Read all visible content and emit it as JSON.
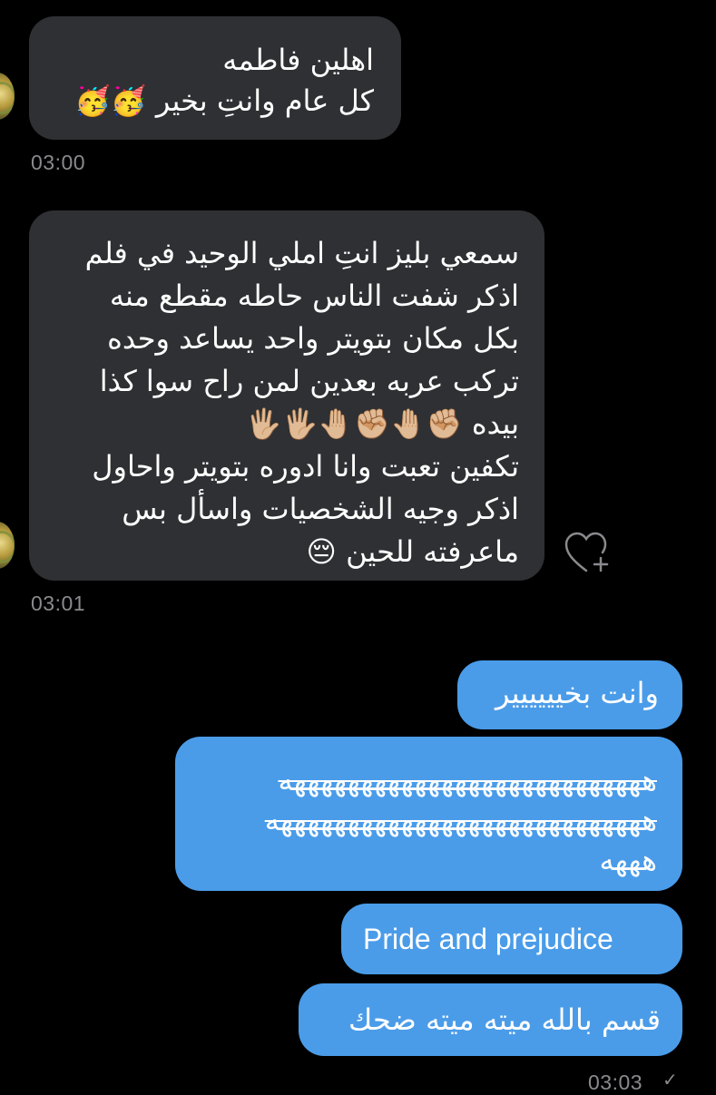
{
  "messages_in": [
    {
      "lines": [
        "اهلين فاطمه",
        "كل عام وانتِ بخير 🥳🥳"
      ],
      "time": "03:00"
    },
    {
      "lines": [
        "سمعي بليز انتِ املي الوحيد في فلم",
        "اذكر شفت الناس حاطه مقطع منه",
        "بكل مكان بتويتر واحد يساعد وحده",
        "تركب عربه بعدين لمن راح سوا كذا",
        "بيده ✊🏼🤚🏼✊🏼🤚🏼🖐🏼🖐🏼",
        "تكفين تعبت وانا ادوره بتويتر واحاول",
        "اذكر وجيه الشخصيات واسأل بس",
        "ماعرفته للحين 😔"
      ],
      "time": "03:01"
    }
  ],
  "messages_out": [
    {
      "lines": [
        "وانت بخيييييير"
      ]
    },
    {
      "lines": [
        "هههههههههههههههههههههههههههه",
        "ههههههههههههههههههههههههههههه",
        "هههه"
      ]
    },
    {
      "lines": [
        "Pride and prejudice"
      ]
    },
    {
      "lines": [
        "قسم بالله ميته ميته ضحك"
      ]
    }
  ],
  "footer": {
    "time": "03:03",
    "status": "✓"
  },
  "colors": {
    "background": "#000000",
    "incoming_bubble": "#2f3033",
    "outgoing_bubble": "#4a9ce9",
    "timestamp": "#8a8a8e"
  },
  "icons": {
    "like": "heart-plus-icon"
  }
}
